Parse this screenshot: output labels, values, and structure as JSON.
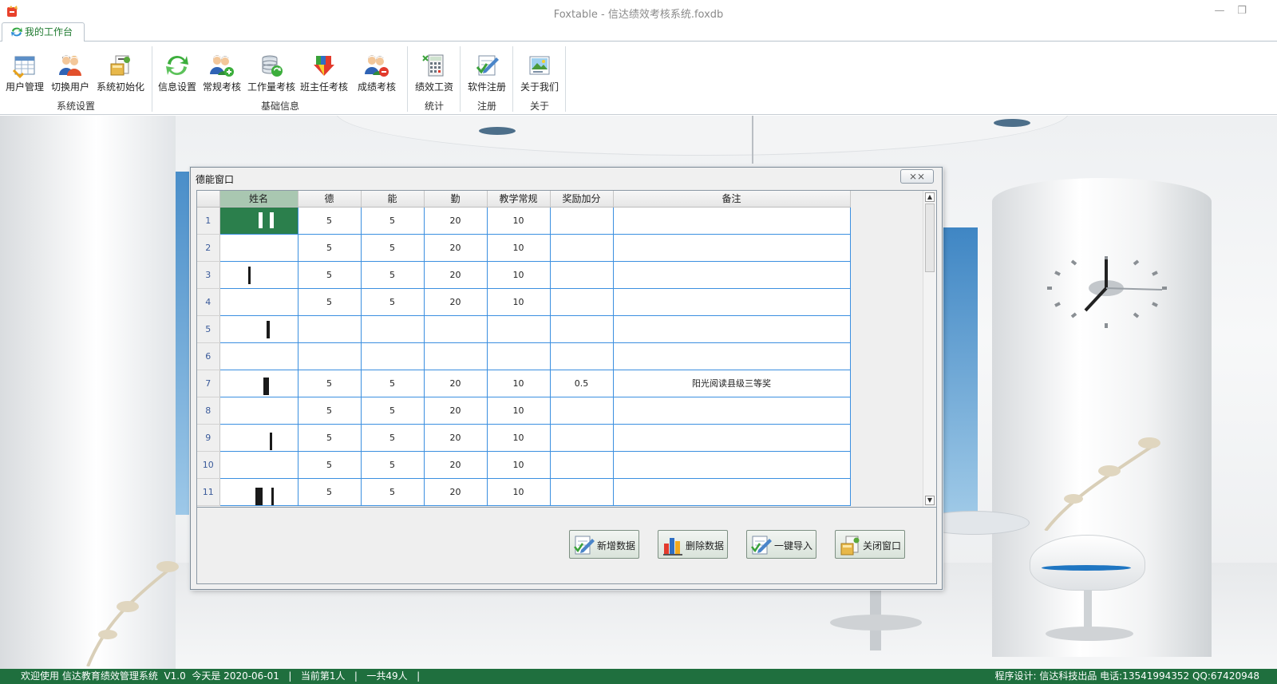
{
  "window": {
    "title": "Foxtable - 信达绩效考核系统.foxdb",
    "minimize": "—",
    "restore": "❐"
  },
  "tabs": {
    "workbench": "我的工作台"
  },
  "ribbon": {
    "groups": [
      {
        "label": "系统设置",
        "buttons": [
          "用户管理",
          "切换用户",
          "系统初始化"
        ]
      },
      {
        "label": "基础信息",
        "buttons": [
          "信息设置",
          "常规考核",
          "工作量考核",
          "班主任考核",
          "成绩考核"
        ]
      },
      {
        "label": "统计",
        "buttons": [
          "绩效工资"
        ]
      },
      {
        "label": "注册",
        "buttons": [
          "软件注册"
        ]
      },
      {
        "label": "关于",
        "buttons": [
          "关于我们"
        ]
      }
    ]
  },
  "dialog": {
    "title": "德能窗口",
    "close_label": "⨯⨯",
    "columns": [
      "姓名",
      "德",
      "能",
      "勤",
      "教学常规",
      "奖励加分",
      "备注"
    ],
    "rows": [
      {
        "n": "1",
        "de": "5",
        "neng": "5",
        "qin": "20",
        "jxcg": "10",
        "jljf": "",
        "bz": ""
      },
      {
        "n": "2",
        "de": "5",
        "neng": "5",
        "qin": "20",
        "jxcg": "10",
        "jljf": "",
        "bz": ""
      },
      {
        "n": "3",
        "de": "5",
        "neng": "5",
        "qin": "20",
        "jxcg": "10",
        "jljf": "",
        "bz": ""
      },
      {
        "n": "4",
        "de": "5",
        "neng": "5",
        "qin": "20",
        "jxcg": "10",
        "jljf": "",
        "bz": ""
      },
      {
        "n": "5",
        "de": "",
        "neng": "",
        "qin": "",
        "jxcg": "",
        "jljf": "",
        "bz": ""
      },
      {
        "n": "6",
        "de": "",
        "neng": "",
        "qin": "",
        "jxcg": "",
        "jljf": "",
        "bz": ""
      },
      {
        "n": "7",
        "de": "5",
        "neng": "5",
        "qin": "20",
        "jxcg": "10",
        "jljf": "0.5",
        "bz": "阳光阅读县级三等奖"
      },
      {
        "n": "8",
        "de": "5",
        "neng": "5",
        "qin": "20",
        "jxcg": "10",
        "jljf": "",
        "bz": ""
      },
      {
        "n": "9",
        "de": "5",
        "neng": "5",
        "qin": "20",
        "jxcg": "10",
        "jljf": "",
        "bz": ""
      },
      {
        "n": "10",
        "de": "5",
        "neng": "5",
        "qin": "20",
        "jxcg": "10",
        "jljf": "",
        "bz": ""
      },
      {
        "n": "11",
        "de": "5",
        "neng": "5",
        "qin": "20",
        "jxcg": "10",
        "jljf": "",
        "bz": ""
      }
    ],
    "actions": {
      "add": "新增数据",
      "delete": "删除数据",
      "import": "一键导入",
      "close": "关闭窗口"
    }
  },
  "status": {
    "left": "欢迎使用 信达教育绩效管理系统  V1.0  今天是 2020-06-01   |   当前第1人   |   一共49人   |",
    "right": "程序设计: 信达科技出品 电话:13541994352 QQ:67420948"
  },
  "colors": {
    "accent_green": "#1f6f3e",
    "grid_line": "#3b8fe0",
    "active_cell": "#2b7f4c"
  }
}
